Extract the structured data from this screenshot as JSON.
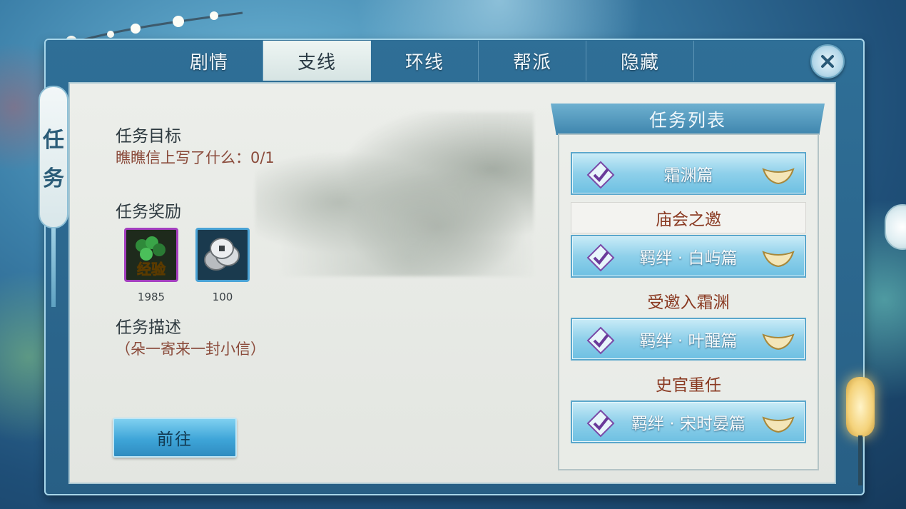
{
  "tabs": [
    {
      "label": "剧情",
      "active": false
    },
    {
      "label": "支线",
      "active": true
    },
    {
      "label": "环线",
      "active": false
    },
    {
      "label": "帮派",
      "active": false
    },
    {
      "label": "隐藏",
      "active": false
    }
  ],
  "side_banner": {
    "char1": "任",
    "char2": "务"
  },
  "task": {
    "objective_heading": "任务目标",
    "objective_text": "瞧瞧信上写了什么：0/1",
    "reward_heading": "任务奖励",
    "rewards": [
      {
        "icon": "exp-icon",
        "icon_text": "经验",
        "amount": "1985"
      },
      {
        "icon": "coin-icon",
        "amount": "100"
      }
    ],
    "description_heading": "任务描述",
    "description_text": "（朵一寄来一封小信）",
    "go_button": "前往"
  },
  "task_list": {
    "title": "任务列表",
    "items": [
      {
        "kind": "chapter",
        "label": "霜渊篇"
      },
      {
        "kind": "quest",
        "label": "庙会之邀"
      },
      {
        "kind": "chapter",
        "label": "羁绊 · 白屿篇"
      },
      {
        "kind": "quest",
        "label": "受邀入霜渊"
      },
      {
        "kind": "chapter",
        "label": "羁绊 · 叶醒篇"
      },
      {
        "kind": "quest",
        "label": "史官重任"
      },
      {
        "kind": "chapter",
        "label": "羁绊 · 宋时晏篇"
      }
    ]
  },
  "colors": {
    "accent": "#3ea5d8",
    "frame": "#2f6f97",
    "quest_text": "#8a3a22"
  }
}
